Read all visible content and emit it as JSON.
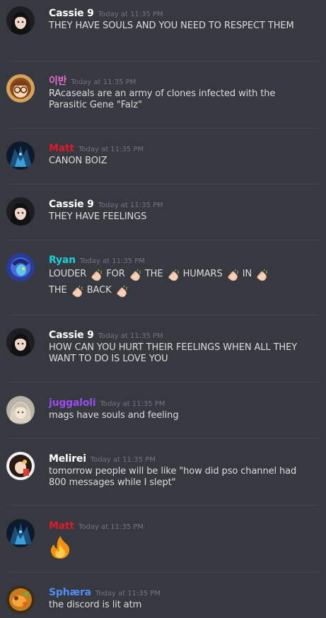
{
  "messages": [
    {
      "author": "Cassie 9",
      "color": "#ffffff",
      "time": "Today at 11:35 PM",
      "text": "THEY HAVE SOULS AND YOU NEED TO RESPECT THEM",
      "avatar": "cassie"
    },
    {
      "author": "이반",
      "color": "#e36ad0",
      "time": "Today at 11:35 PM",
      "text": "RAcaseals are an army of clones infected with the Parasitic Gene \"Falz\"",
      "avatar": "ivan"
    },
    {
      "author": "Matt",
      "color": "#e0182a",
      "time": "Today at 11:35 PM",
      "text": "CANON BOIZ",
      "avatar": "matt"
    },
    {
      "author": "Cassie 9",
      "color": "#ffffff",
      "time": "Today at 11:35 PM",
      "text": "THEY HAVE FEELINGS",
      "avatar": "cassie"
    },
    {
      "author": "Ryan",
      "color": "#1bd1d9",
      "time": "Today at 11:35 PM",
      "words": [
        "LOUDER",
        "FOR",
        "THE",
        "HUMARS",
        "IN",
        "THE",
        "BACK"
      ],
      "emoji": "clapping-hands",
      "avatar": "ryan"
    },
    {
      "author": "Cassie 9",
      "color": "#ffffff",
      "time": "Today at 11:35 PM",
      "text": "HOW CAN YOU HURT THEIR FEELINGS WHEN ALL THEY WANT TO DO IS LOVE YOU",
      "avatar": "cassie"
    },
    {
      "author": "juggaloli",
      "color": "#9b4cf0",
      "time": "Today at 11:35 PM",
      "text": "mags have souls and feeling",
      "avatar": "juggaloli"
    },
    {
      "author": "Melirei",
      "color": "#ffffff",
      "time": "Today at 11:35 PM",
      "text": "tomorrow people will be like \"how did pso channel had 800 messages while I slept\"",
      "avatar": "melirei"
    },
    {
      "author": "Matt",
      "color": "#e0182a",
      "time": "Today at 11:35 PM",
      "emoji": "fire",
      "avatar": "matt"
    },
    {
      "author": "Sphæra",
      "color": "#4f8ff7",
      "time": "Today at 11:35 PM",
      "text": "the discord is lit atm",
      "avatar": "sphaera"
    }
  ]
}
